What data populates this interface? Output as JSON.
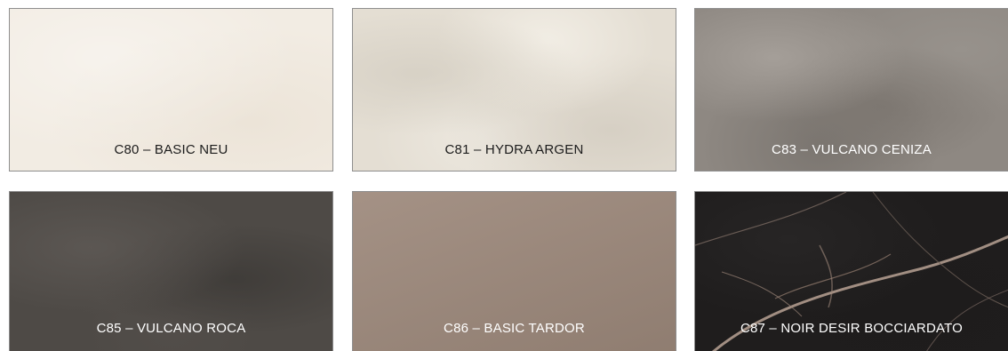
{
  "swatches": [
    {
      "code_label": "C80 – BASIC NEU"
    },
    {
      "code_label": "C81 – HYDRA ARGEN"
    },
    {
      "code_label": "C83 – VULCANO CENIZA"
    },
    {
      "code_label": "C85 – VULCANO ROCA"
    },
    {
      "code_label": "C86 – BASIC TARDOR"
    },
    {
      "code_label": "C87 – NOIR DESIR BOCCIARDATO"
    }
  ],
  "colors": {
    "basic_neu": "#f2ece3",
    "hydra_argen": "#e4ded3",
    "vulcano_ceniza": "#8e8882",
    "vulcano_roca": "#4e4a46",
    "basic_tardor": "#9c887b",
    "noir_desir": "#1f1d1d",
    "border": "#8e8e8e"
  }
}
